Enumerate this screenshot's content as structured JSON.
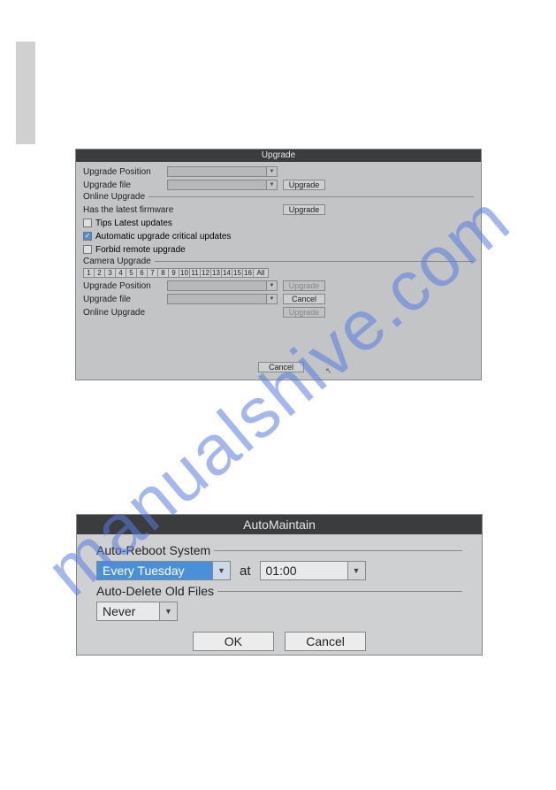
{
  "watermark": "manualshive.com",
  "dialog1": {
    "title": "Upgrade",
    "upgrade_position_label": "Upgrade Position",
    "upgrade_file_label": "Upgrade file",
    "upgrade_btn": "Upgrade",
    "online_upgrade_label": "Online Upgrade",
    "has_latest_label": "Has the latest firmware",
    "chk_tips": "Tips Latest updates",
    "chk_auto": "Automatic upgrade critical updates",
    "chk_forbid": "Forbid remote upgrade",
    "camera_upgrade_label": "Camera Upgrade",
    "numbers": [
      "1",
      "2",
      "3",
      "4",
      "5",
      "6",
      "7",
      "8",
      "9",
      "10",
      "11",
      "12",
      "13",
      "14",
      "15",
      "16",
      "All"
    ],
    "cancel_btn": "Cancel",
    "cam_upgrade_btn": "Upgrade",
    "cam_cancel_btn": "Cancel"
  },
  "dialog2": {
    "title": "AutoMaintain",
    "group_reboot": "Auto-Reboot System",
    "day_value": "Every Tuesday",
    "at_label": "at",
    "time_value": "01:00",
    "group_delete": "Auto-Delete Old Files",
    "delete_value": "Never",
    "ok_btn": "OK",
    "cancel_btn": "Cancel"
  }
}
